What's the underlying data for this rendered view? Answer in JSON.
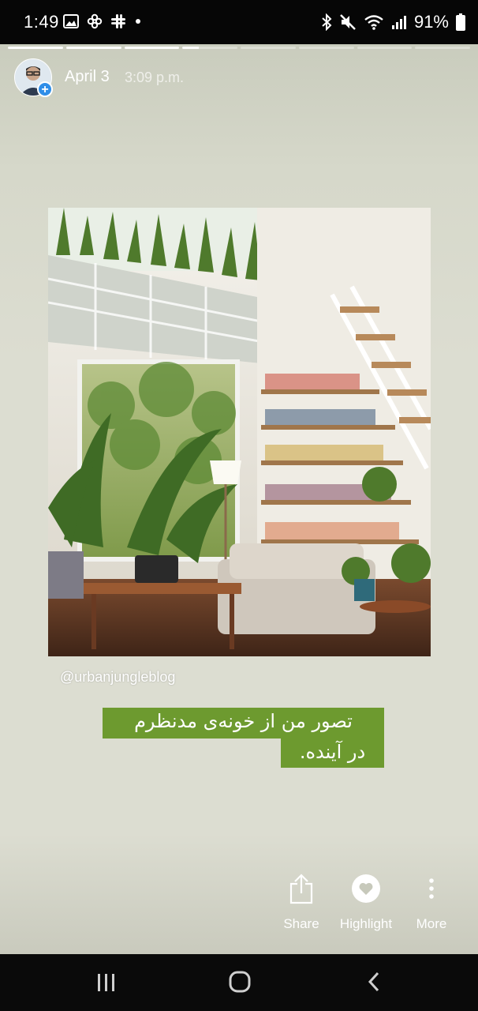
{
  "status_bar": {
    "time": "1:49",
    "battery_percent": "91%",
    "left_icons": [
      "image-notification-icon",
      "pinwheel-app-icon",
      "slack-icon",
      "more-dot-icon"
    ],
    "right_icons": [
      "bluetooth-icon",
      "mute-icon",
      "wifi-icon",
      "signal-icon",
      "battery-icon"
    ]
  },
  "story": {
    "progress": {
      "segments_total": 8,
      "current_segment": 4,
      "current_fraction": 0.3
    },
    "date": "April 3",
    "time": "3:09 p.m.",
    "photo_credit": "@urbanjungleblog",
    "caption_line1": "تصور من از خونه‌ی مدنظرم",
    "caption_line2": "در آینده."
  },
  "actions": {
    "share_label": "Share",
    "highlight_label": "Highlight",
    "more_label": "More"
  },
  "colors": {
    "caption_bg": "#6d9a2f",
    "avatar_badge": "#2f8ee8",
    "background": "#dcddd1"
  }
}
